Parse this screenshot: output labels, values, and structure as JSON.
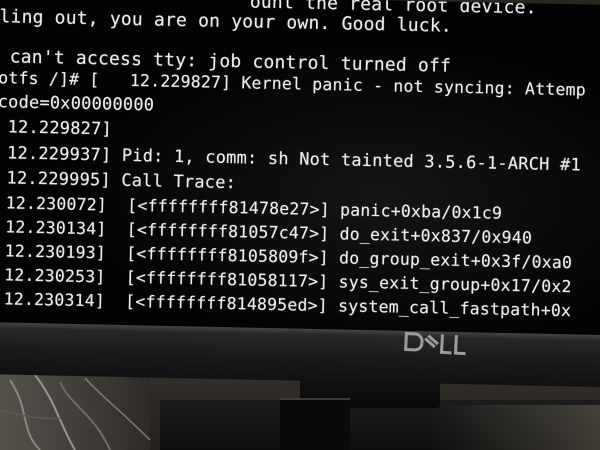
{
  "terminal": {
    "lines": [
      "ling out, you are on your own. Good luck.",
      " can't access tty: job control turned off",
      "otfs /]# [   12.229827] Kernel panic - not syncing: Attemp",
      "code=0x00000000",
      " 12.229827]",
      " 12.229937] Pid: 1, comm: sh Not tainted 3.5.6-1-ARCH #1",
      " 12.229995] Call Trace:",
      " 12.230072]  [<ffffffff81478e27>] panic+0xba/0x1c9",
      " 12.230134]  [<ffffffff81057c47>] do_exit+0x837/0x940",
      " 12.230193]  [<ffffffff8105809f>] do_group_exit+0x3f/0xa0",
      " 12.230253]  [<ffffffff81058117>] sys_exit_group+0x17/0x2",
      " 12.230314]  [<ffffffff814895ed>] system_call_fastpath+0x"
    ],
    "top_fragment": "ount the real root device."
  },
  "monitor": {
    "brand": "DELL"
  },
  "colors": {
    "screen_bg": "#030303",
    "text": "#ececec",
    "bezel": "#1f1f1f"
  }
}
